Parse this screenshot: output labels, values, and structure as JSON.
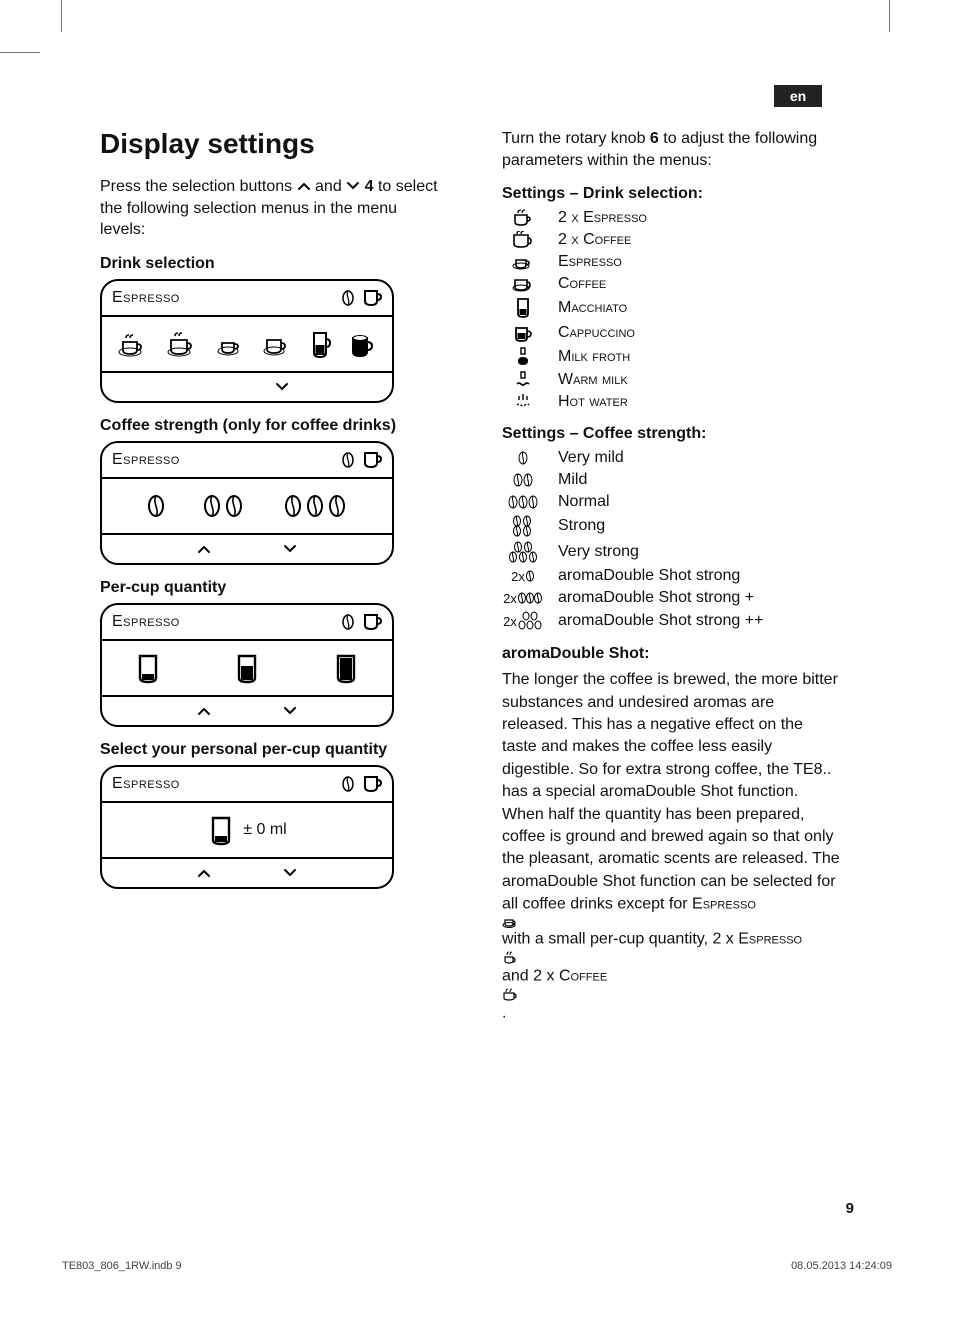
{
  "lang_tag": "en",
  "page_number": "9",
  "footer_file": "TE803_806_1RW.indb   9",
  "footer_time": "08.05.2013   14:24:09",
  "left": {
    "title": "Display settings",
    "intro_a": "Press the selection buttons ",
    "intro_b": " and ",
    "intro_c": " 4 to select the following selection menus in the menu levels:",
    "sec1": "Drink selection",
    "sec2": "Coffee strength (only for coffee drinks)",
    "sec3": "Per-cup quantity",
    "sec4": "Select your personal per-cup quantity",
    "panel_label": "Espresso",
    "ml_label": "± 0 ml"
  },
  "right": {
    "intro_a": "Turn the rotary knob ",
    "intro_b": "6",
    "intro_c": " to adjust the follow­ing parameters within the menus:",
    "drinksel_title": "Settings – Drink selection:",
    "drinks": [
      "2 x Espresso",
      "2 x Coffee",
      "Espresso",
      "Coffee",
      "Macchiato",
      "Cappuccino",
      "Milk froth",
      "Warm milk",
      "Hot water"
    ],
    "strength_title": "Settings – Coffee strength:",
    "strength": [
      {
        "sym": "1",
        "label": "Very mild"
      },
      {
        "sym": "2",
        "label": "Mild"
      },
      {
        "sym": "3",
        "label": "Normal"
      },
      {
        "sym": "4",
        "label": "Strong"
      },
      {
        "sym": "5",
        "label": "Very strong"
      },
      {
        "sym": "2x1",
        "label": "aromaDouble Shot strong"
      },
      {
        "sym": "2x3",
        "label": "aromaDouble Shot strong +"
      },
      {
        "sym": "2x5",
        "label": "aromaDouble Shot strong ++"
      }
    ],
    "aroma_title": "aromaDouble Shot:",
    "aroma_body_a": "The longer the coffee is brewed, the more bitter substances and undesired aromas are released. This has a nega­tive effect on the taste and makes the coffee less easily digestible. So for extra strong coffee, the TE8.. has a special aromaDouble Shot function. When half the quantity has been prepared, coffee is ground and brewed again so that only the pleasant, aromatic scents are released. The aromaDouble Shot function can be selected for all coffee drinks except for ",
    "aroma_esp": "Espresso",
    "aroma_mid": " with a small per-cup quantity, 2 x ",
    "aroma_esp2": "Espresso",
    "aroma_and": " and 2 x ",
    "aroma_coffee": "Coffee",
    "aroma_end": "."
  }
}
